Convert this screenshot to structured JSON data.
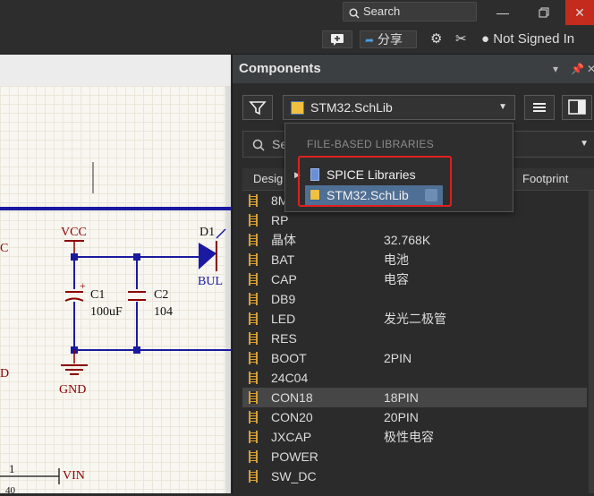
{
  "titlebar": {
    "search_label": "Search",
    "search_icon": "search-icon",
    "maximize_icon": "restore-icon",
    "close_icon": "close-icon"
  },
  "toolbar": {
    "comment_icon": "comment-plus-icon",
    "share_label": "分享",
    "settings_icon": "gear-icon",
    "tools_icon": "tools-icon",
    "user_icon": "user-icon",
    "user_status": "Not Signed In"
  },
  "schematic": {
    "labels": {
      "vcc": "VCC",
      "gnd": "GND",
      "c1_ref": "C1",
      "c1_val": "100uF",
      "c2_ref": "C2",
      "c2_val": "104",
      "d1_ref": "D1",
      "d1_val": "BUL",
      "left_c": "C",
      "left_d": "D",
      "vin": "VIN",
      "pin1": "1",
      "pin40": "40",
      "plus": "+"
    }
  },
  "panel": {
    "title": "Components",
    "library_selected": "STM32.SchLib",
    "search_placeholder": "Se",
    "columns": {
      "design": "Desig",
      "footprint": "Footprint"
    },
    "dropdown": {
      "header": "FILE-BASED LIBRARIES",
      "items": [
        {
          "label": "SPICE Libraries"
        },
        {
          "label": "STM32.SchLib"
        }
      ]
    },
    "rows": [
      {
        "name": "8M",
        "desc": ""
      },
      {
        "name": "RP",
        "desc": ""
      },
      {
        "name": "晶体",
        "desc": "32.768K"
      },
      {
        "name": "BAT",
        "desc": "电池"
      },
      {
        "name": "CAP",
        "desc": "电容"
      },
      {
        "name": "DB9",
        "desc": ""
      },
      {
        "name": "LED",
        "desc": "发光二极管"
      },
      {
        "name": "RES",
        "desc": ""
      },
      {
        "name": "BOOT",
        "desc": "2PIN"
      },
      {
        "name": "24C04",
        "desc": ""
      },
      {
        "name": "CON18",
        "desc": "18PIN"
      },
      {
        "name": "CON20",
        "desc": "20PIN"
      },
      {
        "name": "JXCAP",
        "desc": "极性电容"
      },
      {
        "name": "POWER",
        "desc": ""
      },
      {
        "name": "SW_DC",
        "desc": ""
      }
    ]
  },
  "colors": {
    "accent_highlight": "#e02020",
    "selection": "#4f6f95",
    "wire": "#1a1aa0",
    "component": "#8b0000"
  }
}
